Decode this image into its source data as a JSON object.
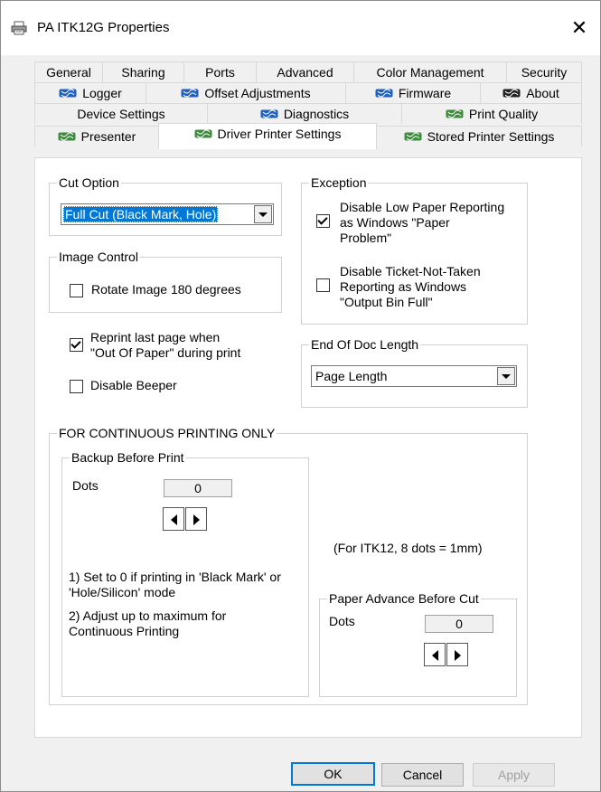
{
  "window": {
    "title": "PA ITK12G Properties",
    "icon": "printer-icon",
    "close_glyph": "✕"
  },
  "tabs": {
    "row1": [
      {
        "label": "General"
      },
      {
        "label": "Sharing"
      },
      {
        "label": "Ports"
      },
      {
        "label": "Advanced"
      },
      {
        "label": "Color Management"
      },
      {
        "label": "Security"
      }
    ],
    "row2": [
      {
        "label": "Logger"
      },
      {
        "label": "Offset Adjustments"
      },
      {
        "label": "Firmware"
      },
      {
        "label": "About"
      }
    ],
    "row3": [
      {
        "label": "Device Settings"
      },
      {
        "label": "Diagnostics"
      },
      {
        "label": "Print Quality"
      }
    ],
    "row4": [
      {
        "label": "Presenter"
      },
      {
        "label": "Driver Printer Settings"
      },
      {
        "label": "Stored Printer Settings"
      }
    ],
    "selected": "Driver Printer Settings"
  },
  "cut_option": {
    "title": "Cut Option",
    "value": "Full Cut (Black Mark, Hole)"
  },
  "exception": {
    "title": "Exception",
    "low_paper": {
      "label": "Disable Low Paper Reporting\nas Windows \"Paper\nProblem\"",
      "checked": true
    },
    "ticket_not_taken": {
      "label": "Disable Ticket-Not-Taken\nReporting as Windows\n\"Output Bin Full\"",
      "checked": false
    }
  },
  "image_control": {
    "title": "Image Control",
    "rotate": {
      "label": "Rotate Image 180 degrees",
      "checked": false
    }
  },
  "reprint": {
    "label": "Reprint last page when\n\"Out Of Paper\" during print",
    "checked": true
  },
  "beeper": {
    "label": "Disable Beeper",
    "checked": false
  },
  "end_of_doc": {
    "title": "End Of Doc Length",
    "value": "Page Length"
  },
  "continuous": {
    "title": "FOR CONTINUOUS PRINTING ONLY",
    "backup": {
      "title": "Backup Before Print",
      "dots_label": "Dots",
      "dots_value": "0",
      "note1": "1) Set to 0 if printing in 'Black Mark' or\n'Hole/Silicon' mode",
      "note2": "2) Adjust up to maximum for\nContinuous Printing"
    },
    "info": "(For ITK12, 8 dots = 1mm)",
    "advance": {
      "title": "Paper Advance Before Cut",
      "dots_label": "Dots",
      "dots_value": "0"
    }
  },
  "buttons": {
    "ok": "OK",
    "cancel": "Cancel",
    "apply": "Apply"
  },
  "colors": {
    "selection": "#0078d7",
    "tab_icon_green": "#3c8c3c",
    "tab_icon_blue": "#1f5fbf"
  }
}
